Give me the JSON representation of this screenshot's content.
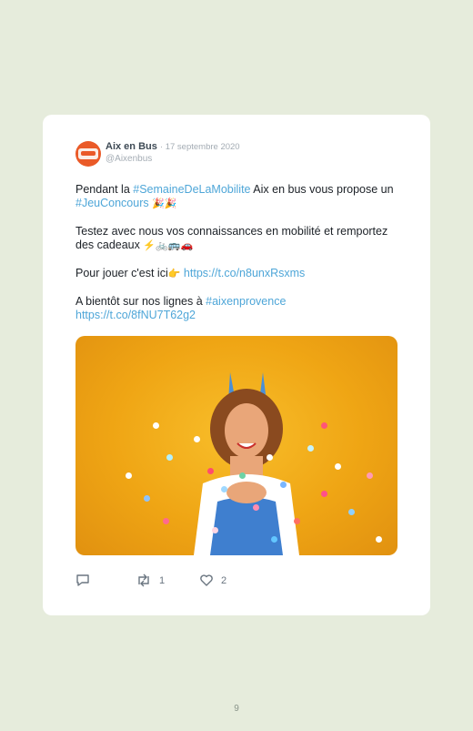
{
  "tweet": {
    "author_name": "Aix en Bus",
    "date": "· 17 septembre 2020",
    "handle": "@Aixenbus",
    "line1_pre": "Pendant la ",
    "hashtag1": "#SemaineDeLaMobilite",
    "line1_post": " Aix en bus vous propose un ",
    "hashtag2": "#JeuConcours",
    "emoji1": "🎉🎉",
    "para2": "Testez avec nous vos connaissances en mobilité et remportez des cadeaux ",
    "emoji2": "⚡🚲🚌🚗",
    "para3_pre": "Pour jouer c'est ici",
    "emoji3": "👉",
    "link1": "https://t.co/n8unxRsxms",
    "para4_pre": "A bientôt sur nos lignes à ",
    "hashtag3": "#aixenprovence",
    "link2": "https://t.co/8fNU7T62g2"
  },
  "actions": {
    "reply_icon": "reply-icon",
    "retweet_icon": "retweet-icon",
    "retweet_count": "1",
    "like_icon": "heart-icon",
    "like_count": "2"
  },
  "page_number": "9",
  "colors": {
    "background": "#e6ecdc",
    "link": "#4ea6d8",
    "brand": "#ea5a28"
  }
}
